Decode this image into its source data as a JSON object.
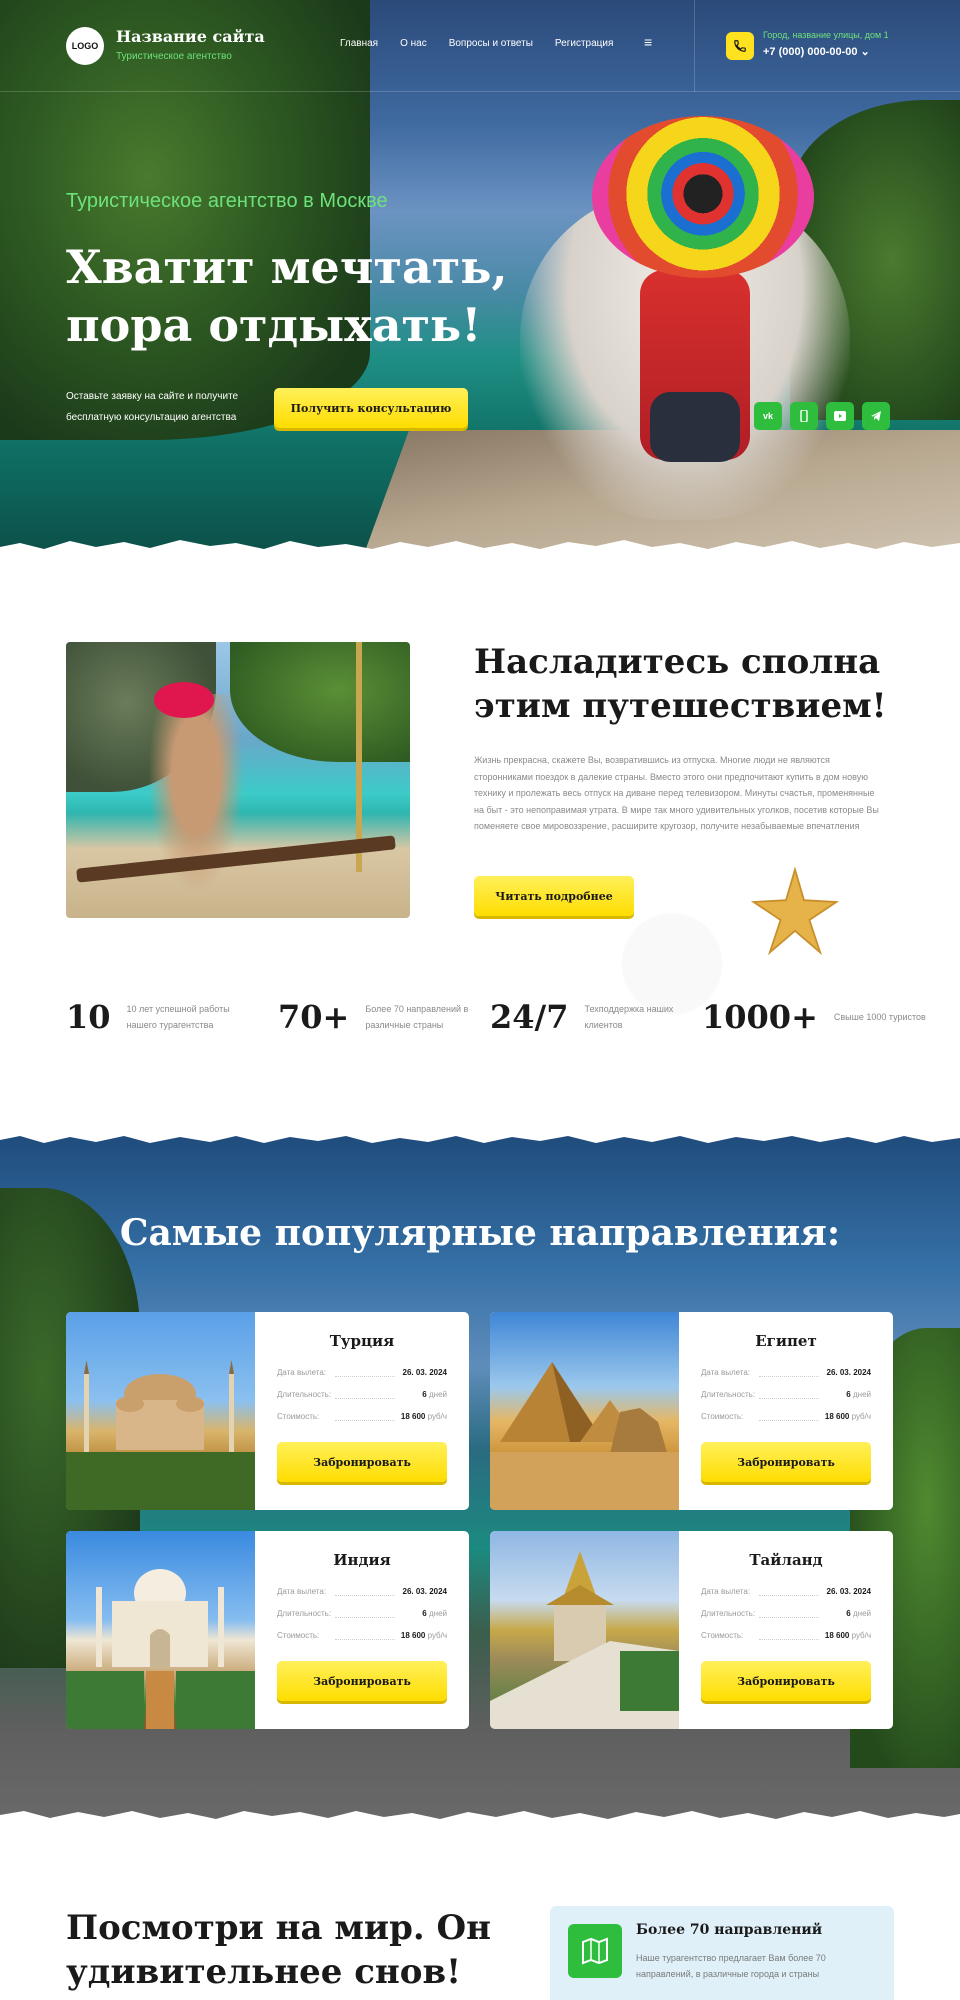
{
  "header": {
    "logo_text": "LOGO",
    "site_name": "Название сайта",
    "site_subtitle": "Туристическое агентство",
    "nav": [
      "Главная",
      "О нас",
      "Вопросы и ответы",
      "Регистрация"
    ],
    "menu_glyph": "≡",
    "address": "Город, название улицы, дом 1",
    "phone": "+7 (000) 000-00-00 ⌄"
  },
  "hero": {
    "kicker": "Туристическое агентство в Москве",
    "title": "Хватит мечтать, пора отдыхать!",
    "text": "Оставьте заявку на сайте и получите бесплатную консультацию агентства",
    "button": "Получить консультацию",
    "socials": [
      "vk-icon",
      "viber-icon",
      "youtube-icon",
      "telegram-icon"
    ]
  },
  "about": {
    "title": "Насладитесь сполна этим путешествием!",
    "text": "Жизнь прекрасна, скажете Вы, возвратившись из отпуска. Многие люди не являются сторонниками поездок в далекие страны. Вместо этого они предпочитают купить в дом новую технику и пролежать весь отпуск на диване перед телевизором. Минуты счастья, променянные на быт - это непоправимая утрата. В мире так много удивительных уголков, посетив которые Вы поменяете свое мировоззрение, расширите кругозор, получите незабываемые впечатления",
    "button": "Читать подробнее"
  },
  "stats": [
    {
      "num": "10",
      "text": "10 лет успешной работы нашего турагентства"
    },
    {
      "num": "70+",
      "text": "Более 70 направлений в различные страны"
    },
    {
      "num": "24/7",
      "text": "Техподдержка наших клиентов"
    },
    {
      "num": "1000+",
      "text": "Свыше 1000 туристов"
    }
  ],
  "destinations": {
    "title": "Самые популярные направления:",
    "labels": {
      "date": "Дата вылета:",
      "duration": "Длительность:",
      "price": "Стоимость:"
    },
    "cards": [
      {
        "name": "Турция",
        "date": "26. 03. 2024",
        "days": "6",
        "days_unit": "дней",
        "price": "18 600",
        "currency": "руб/ч",
        "button": "Забронировать"
      },
      {
        "name": "Египет",
        "date": "26. 03. 2024",
        "days": "6",
        "days_unit": "дней",
        "price": "18 600",
        "currency": "руб/ч",
        "button": "Забронировать"
      },
      {
        "name": "Индия",
        "date": "26. 03. 2024",
        "days": "6",
        "days_unit": "дней",
        "price": "18 600",
        "currency": "руб/ч",
        "button": "Забронировать"
      },
      {
        "name": "Тайланд",
        "date": "26. 03. 2024",
        "days": "6",
        "days_unit": "дней",
        "price": "18 600",
        "currency": "руб/ч",
        "button": "Забронировать"
      }
    ]
  },
  "world": {
    "title": "Посмотри на мир. Он удивительнее снов!",
    "feature_title": "Более 70 направлений",
    "feature_text": "Наше турагентство предлагает Вам более 70 направлений, в различные города и страны"
  },
  "colors": {
    "accent_yellow": "#ffe21f",
    "accent_green": "#2fbd3e",
    "kicker_green": "#6ee27a"
  }
}
